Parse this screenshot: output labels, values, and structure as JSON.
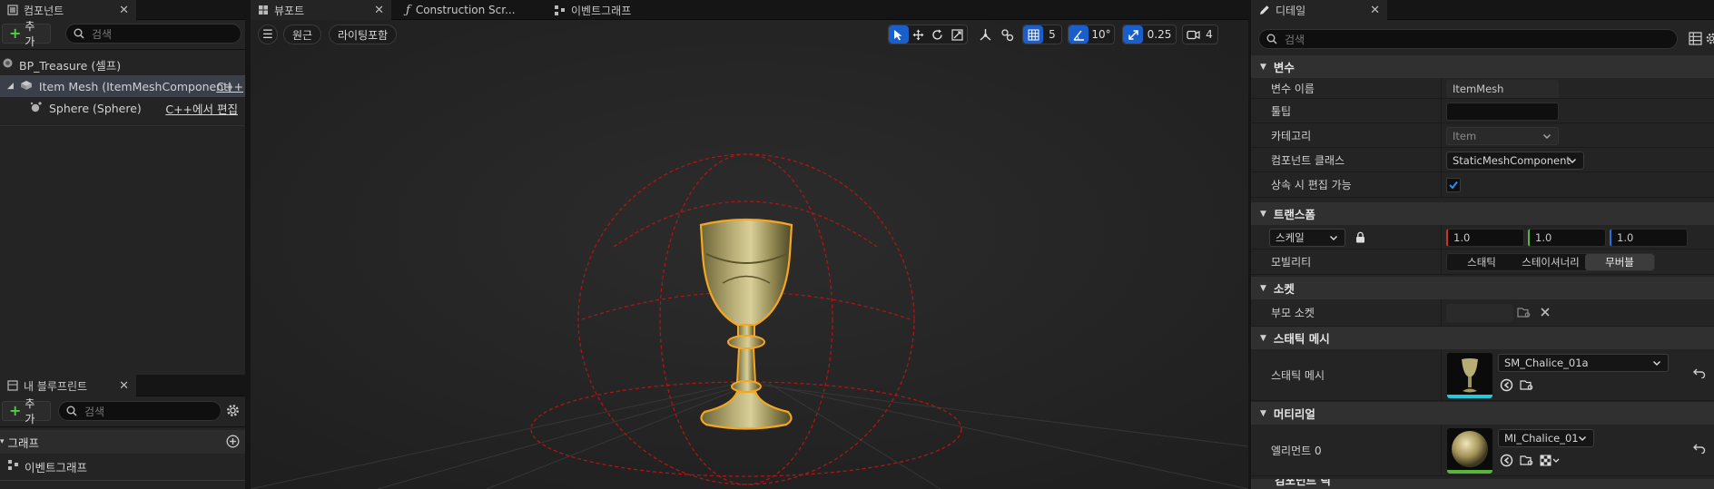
{
  "left": {
    "components_tab": "컴포넌트",
    "add_label": "추가",
    "search_placeholder": "검색",
    "tree": [
      {
        "label": "BP_Treasure (셀프)"
      },
      {
        "label": "Item Mesh (ItemMeshComponent)",
        "tag": "C++"
      },
      {
        "label": "Sphere (Sphere)",
        "tag": "C++에서 편집"
      }
    ],
    "blueprint_tab": "내 블루프린트",
    "bp_add_label": "추가",
    "bp_search_placeholder": "검색",
    "graph_section": "그래프",
    "graph_item": "이벤트그래프"
  },
  "viewport": {
    "tabs": [
      "뷰포트",
      "Construction Scr...",
      "이벤트그래프"
    ],
    "perspective": "원근",
    "lighting": "라이팅포함",
    "grid_snap": "5",
    "rotate_snap": "10°",
    "scale_snap": "0.25",
    "camera_speed": "4"
  },
  "details": {
    "tab": "디테일",
    "search_placeholder": "검색",
    "sections": {
      "variable": "변수",
      "transform": "트랜스폼",
      "socket": "소켓",
      "static_mesh": "스태틱 메시",
      "material": "머티리얼",
      "next": "컴포넌트 틱"
    },
    "var_name_label": "변수 이름",
    "var_name_value": "ItemMesh",
    "tooltip_label": "툴팁",
    "tooltip_value": "",
    "category_label": "카테고리",
    "category_value": "Item",
    "comp_class_label": "컴포넌트 클래스",
    "comp_class_value": "StaticMeshComponent",
    "editable_label": "상속 시 편집 가능",
    "editable_checked": true,
    "scale_label": "스케일",
    "scale_x": "1.0",
    "scale_y": "1.0",
    "scale_z": "1.0",
    "mobility_label": "모빌리티",
    "mobility_options": [
      "스태틱",
      "스테이셔너리",
      "무버블"
    ],
    "mobility_selected": "무버블",
    "parent_socket_label": "부모 소켓",
    "static_mesh_label": "스태틱 메시",
    "static_mesh_value": "SM_Chalice_01a",
    "element0_label": "엘리먼트 0",
    "element0_value": "MI_Chalice_01"
  },
  "colors": {
    "accent_blue": "#1a5ec9",
    "selection_orange": "#f5a623",
    "collision_red": "#b01515",
    "add_green": "#57c84a"
  }
}
